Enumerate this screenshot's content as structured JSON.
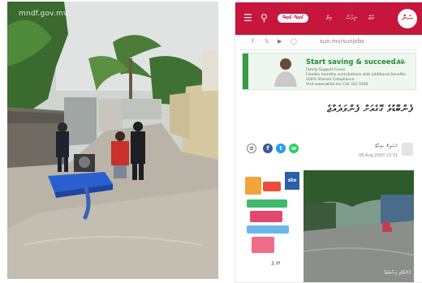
{
  "left_photo": {
    "watermark": "mndf.gov.mv"
  },
  "phone": {
    "header": {
      "menu_icon": "hamburger-icon",
      "search_icon": "search-icon",
      "brand_label": "ᠲᠳ ᠳᠳ",
      "nav_items": [
        "ތާޒާ",
        "ނިއުސް",
        "ބިޒް"
      ],
      "logo_text": "ސަން",
      "accent": "#c6163c"
    },
    "social": {
      "icons": [
        "facebook-icon",
        "twitter-icon",
        "youtube-icon",
        "instagram-icon"
      ],
      "domain": "sun.mv/sunjobs"
    },
    "ad": {
      "headline": "Start saving & succeed...",
      "line1": "Family Support Cover",
      "line2": "Flexible monthly contributions with additional benefits",
      "line3": "100% Shariah Compliance",
      "line4": "Visit www.allied.mv  Call 333 5544",
      "logo": "AIL"
    },
    "article": {
      "headline": "ފެންބޮޑުވެ ގޭގެއަށް ފެންވަދެއްޖެ",
      "author": "ހުސައިން ޝިހާބް",
      "date": "08 Aug 2020 13:31",
      "share": [
        "comment",
        "facebook",
        "twitter",
        "whatsapp"
      ]
    },
    "side_ad": {
      "badge": "sto",
      "caption": "3 ކޮމް"
    },
    "photo_caption": "ފެންބޮޑުވި ހިސާބުތައް"
  }
}
